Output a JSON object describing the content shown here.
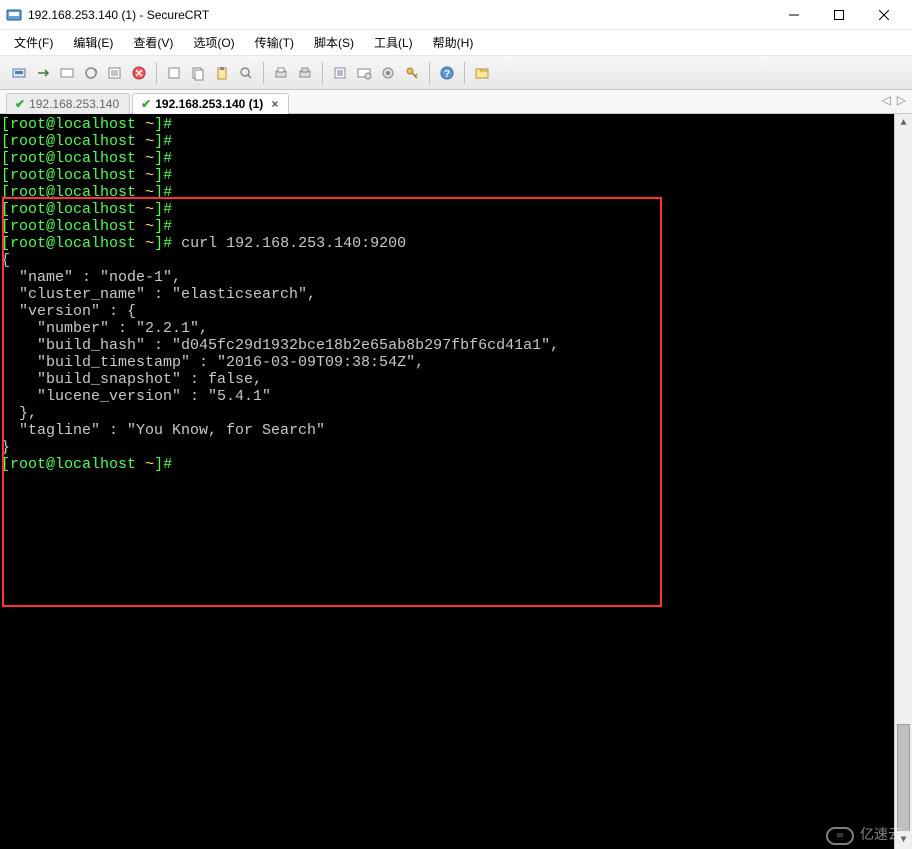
{
  "window": {
    "title": "192.168.253.140 (1) - SecureCRT"
  },
  "menu": {
    "file": "文件(F)",
    "edit": "编辑(E)",
    "view": "查看(V)",
    "options": "选项(O)",
    "transfer": "传输(T)",
    "script": "脚本(S)",
    "tools": "工具(L)",
    "help": "帮助(H)"
  },
  "tabs": {
    "items": [
      {
        "label": "192.168.253.140",
        "active": false
      },
      {
        "label": "192.168.253.140 (1)",
        "active": true
      }
    ]
  },
  "terminal": {
    "prompt_user": "root@localhost",
    "prompt_path": "~",
    "command": "curl 192.168.253.140:9200",
    "response": {
      "name": "node-1",
      "cluster_name": "elasticsearch",
      "version": {
        "number": "2.2.1",
        "build_hash": "d045fc29d1932bce18b2e65ab8b297fbf6cd41a1",
        "build_timestamp": "2016-03-09T09:38:54Z",
        "build_snapshot": false,
        "lucene_version": "5.4.1"
      },
      "tagline": "You Know, for Search"
    },
    "lines": [
      "[root@localhost ~]#",
      "[root@localhost ~]#",
      "[root@localhost ~]#",
      "[root@localhost ~]#",
      "[root@localhost ~]#",
      "[root@localhost ~]#",
      "[root@localhost ~]#",
      "[root@localhost ~]# curl 192.168.253.140:9200",
      "{",
      "  \"name\" : \"node-1\",",
      "  \"cluster_name\" : \"elasticsearch\",",
      "  \"version\" : {",
      "    \"number\" : \"2.2.1\",",
      "    \"build_hash\" : \"d045fc29d1932bce18b2e65ab8b297fbf6cd41a1\",",
      "    \"build_timestamp\" : \"2016-03-09T09:38:54Z\",",
      "    \"build_snapshot\" : false,",
      "    \"lucene_version\" : \"5.4.1\"",
      "  },",
      "  \"tagline\" : \"You Know, for Search\"",
      "}",
      "[root@localhost ~]#"
    ]
  },
  "watermark": {
    "text": "亿速云"
  }
}
